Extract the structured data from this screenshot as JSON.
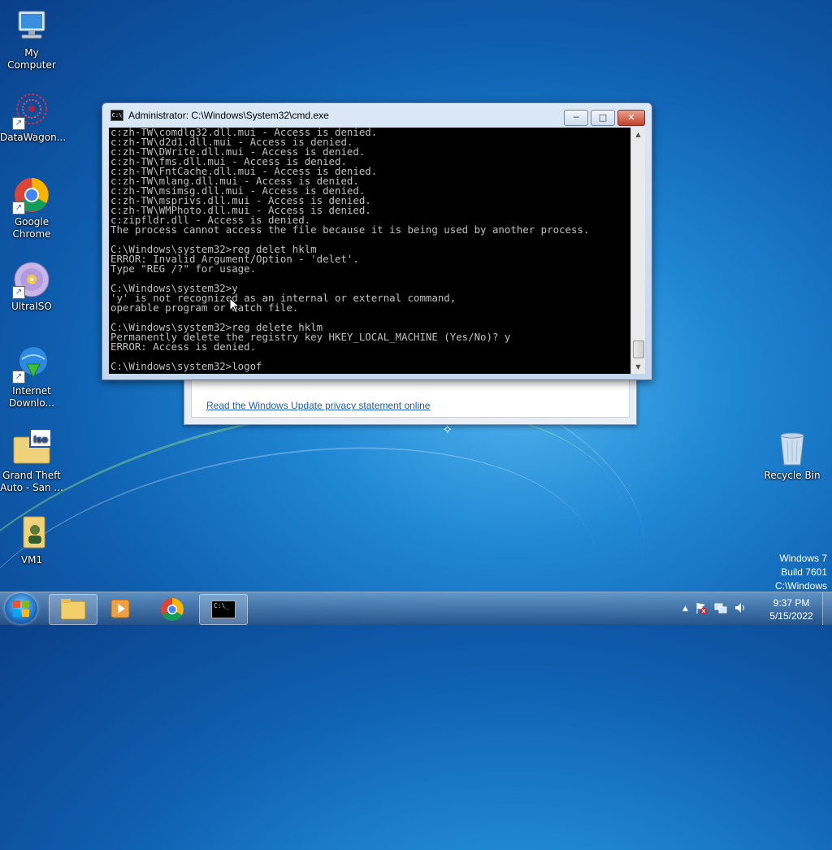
{
  "desktop": {
    "icons": [
      {
        "label": "My Computer"
      },
      {
        "label": "DataWagon..."
      },
      {
        "label": "Google Chrome"
      },
      {
        "label": "UltraISO"
      },
      {
        "label": "Internet Downlo..."
      },
      {
        "label": "Grand Theft Auto - San ..."
      },
      {
        "label": "VM1"
      },
      {
        "label": "Recycle Bin"
      }
    ],
    "watermark": {
      "line1": "Windows 7",
      "line2": "Build 7601",
      "line3": "C:\\Windows"
    }
  },
  "background_window": {
    "link": "Read the Windows Update privacy statement online"
  },
  "cmd_window": {
    "title": "Administrator: C:\\Windows\\System32\\cmd.exe",
    "icon_label": "C:\\",
    "buttons": {
      "minimize": "─",
      "maximize": "□",
      "close": "✕"
    },
    "lines": [
      "c:zh-TW\\comdlg32.dll.mui - Access is denied.",
      "c:zh-TW\\d2d1.dll.mui - Access is denied.",
      "c:zh-TW\\DWrite.dll.mui - Access is denied.",
      "c:zh-TW\\fms.dll.mui - Access is denied.",
      "c:zh-TW\\FntCache.dll.mui - Access is denied.",
      "c:zh-TW\\mlang.dll.mui - Access is denied.",
      "c:zh-TW\\msimsg.dll.mui - Access is denied.",
      "c:zh-TW\\msprivs.dll.mui - Access is denied.",
      "c:zh-TW\\WMPhoto.dll.mui - Access is denied.",
      "c:zipfldr.dll - Access is denied.",
      "The process cannot access the file because it is being used by another process.",
      "",
      "C:\\Windows\\system32>reg delet hklm",
      "ERROR: Invalid Argument/Option - 'delet'.",
      "Type \"REG /?\" for usage.",
      "",
      "C:\\Windows\\system32>y",
      "'y' is not recognized as an internal or external command,",
      "operable program or batch file.",
      "",
      "C:\\Windows\\system32>reg delete hklm",
      "Permanently delete the registry key HKEY_LOCAL_MACHINE (Yes/No)? y",
      "ERROR: Access is denied.",
      "",
      "C:\\Windows\\system32>logof"
    ]
  },
  "taskbar": {
    "cmd_button_label": "C:\\_",
    "clock": {
      "time": "9:37 PM",
      "date": "5/15/2022"
    }
  }
}
